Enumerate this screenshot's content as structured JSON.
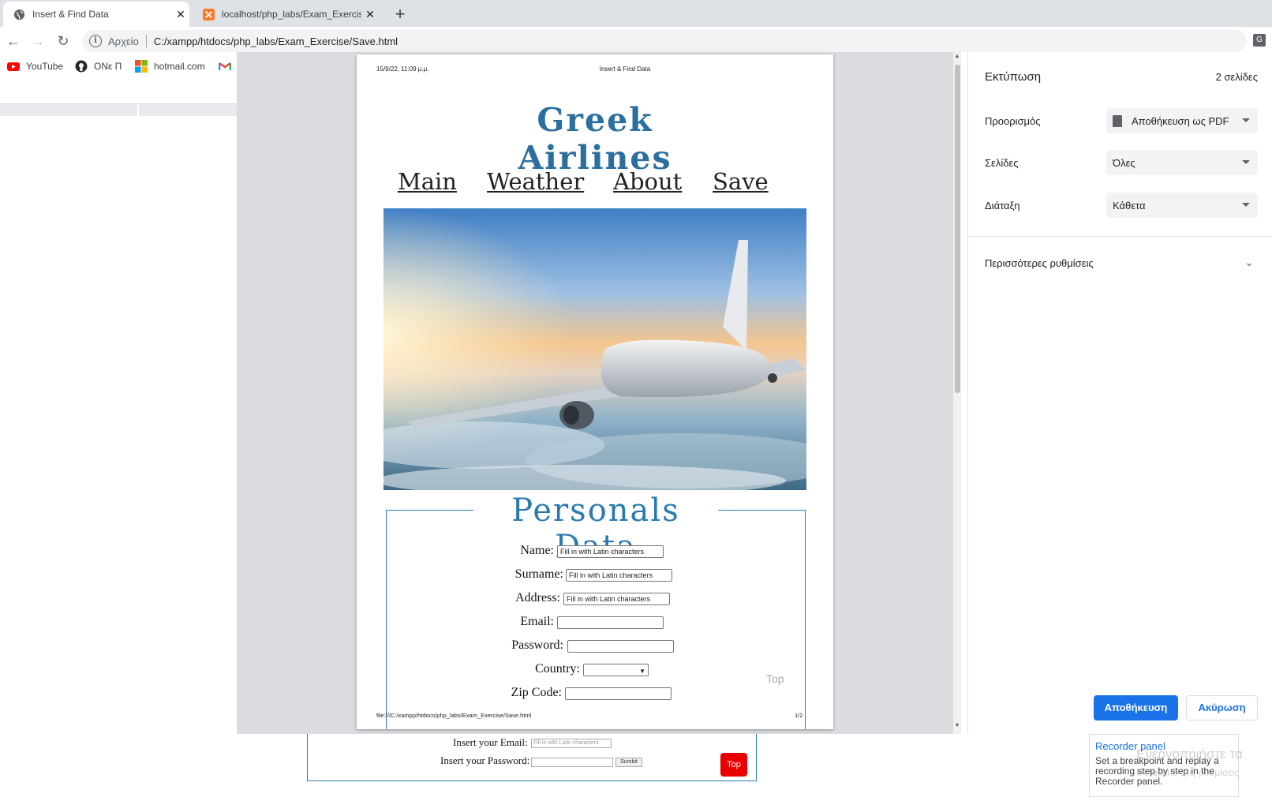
{
  "tabs": [
    {
      "title": "Insert & Find Data",
      "active": true
    },
    {
      "title": "localhost/php_labs/Exam_Exercise",
      "active": false
    }
  ],
  "omnibox": {
    "scheme": "Αρχείο",
    "url": "C:/xampp/htdocs/php_labs/Exam_Exercise/Save.html"
  },
  "bookmarks": [
    {
      "label": "YouTube",
      "icon": "youtube-icon"
    },
    {
      "label": "ONε Π",
      "icon": "github-icon"
    },
    {
      "label": "hotmail.com",
      "icon": "microsoft-icon"
    },
    {
      "label": "",
      "icon": "gmail-icon"
    }
  ],
  "print_preview": {
    "header_date": "15/9/22, 11:09 μ.μ.",
    "header_title": "Insert & Find Data",
    "site_title": "Greek Airlines",
    "nav": [
      "Main",
      "Weather",
      "About",
      "Save"
    ],
    "section_title": "Personals Data",
    "fields": [
      {
        "label": "Name:",
        "value": "Fill in with Latin characters"
      },
      {
        "label": "Surname:",
        "value": "Fill in with Latin characters"
      },
      {
        "label": "Address:",
        "value": "Fill in with Latin characters"
      },
      {
        "label": "Email:",
        "value": ""
      },
      {
        "label": "Password:",
        "value": ""
      },
      {
        "label": "Country:",
        "value": ""
      },
      {
        "label": "Zip Code:",
        "value": ""
      }
    ],
    "top_link": "Top",
    "footer_url": "file:///C:/xampp/htdocs/php_labs/Exam_Exercise/Save.html",
    "footer_page": "1/2"
  },
  "print_panel": {
    "title": "Εκτύπωση",
    "page_count": "2 σελίδες",
    "destination_label": "Προορισμός",
    "destination_value": "Αποθήκευση ως PDF",
    "pages_label": "Σελίδες",
    "pages_value": "Όλες",
    "layout_label": "Διάταξη",
    "layout_value": "Κάθετα",
    "more_settings": "Περισσότερες ρυθμίσεις",
    "save_label": "Αποθήκευση",
    "cancel_label": "Ακύρωση"
  },
  "background_page": {
    "email_label": "Insert your Email:",
    "email_placeholder": "Fill in with Latin characters",
    "password_label": "Insert your Password:",
    "submit_label": "Sumbit",
    "top_button": "Top"
  },
  "devtools": {
    "title": "Recorder panel",
    "description": "Set a breakpoint and replay a recording step by step in the Recorder panel."
  },
  "watermark": {
    "line1": "Ενεργοποιήστε τα",
    "line2": "Μεταβείτε στις ρυθμίσεις"
  },
  "colors": {
    "accent": "#2a7ab0",
    "chrome_blue": "#1a73e8",
    "top_button": "#e80000"
  }
}
